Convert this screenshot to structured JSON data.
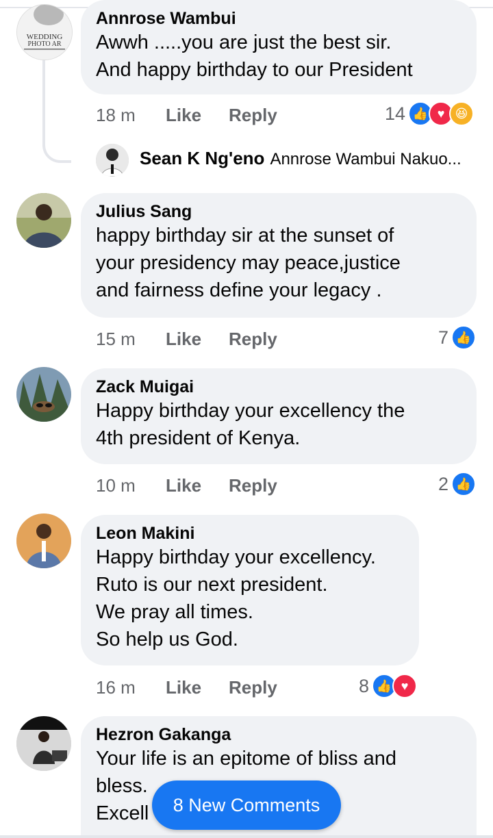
{
  "comments": [
    {
      "name": "Annrose Wambui",
      "lines": [
        "Awwh .....you are just the best sir.",
        "And happy birthday to our President"
      ],
      "time": "18 m",
      "like": "Like",
      "reply": "Reply",
      "reactions": "14",
      "reaction_icons": [
        "like-icon",
        "love-icon",
        "haha-icon"
      ],
      "avatar_text": "WEDDING PHOTO AR",
      "reply_preview": {
        "name": "Sean K Ng'eno",
        "text": "Annrose Wambui Nakuo..."
      }
    },
    {
      "name": "Julius Sang",
      "lines": [
        "happy birthday sir at the sunset of",
        "your presidency may peace,justice",
        "and fairness define your legacy ."
      ],
      "time": "15 m",
      "like": "Like",
      "reply": "Reply",
      "reactions": "7",
      "reaction_icons": [
        "like-icon"
      ]
    },
    {
      "name": "Zack Muigai",
      "lines": [
        "Happy birthday your excellency the",
        "4th president of Kenya."
      ],
      "time": "10 m",
      "like": "Like",
      "reply": "Reply",
      "reactions": "2",
      "reaction_icons": [
        "like-icon"
      ]
    },
    {
      "name": "Leon Makini",
      "lines": [
        "Happy birthday your excellency.",
        "Ruto is our next president.",
        "We pray all times.",
        "So help us God."
      ],
      "time": "16 m",
      "like": "Like",
      "reply": "Reply",
      "reactions": "8",
      "reaction_icons": [
        "like-icon",
        "love-icon"
      ]
    },
    {
      "name": "Hezron Gakanga",
      "lines": [
        "Your life is an epitome of bliss and",
        "bless.                    ur",
        "Excell"
      ]
    }
  ],
  "new_comments_button": "8 New Comments",
  "colors": {
    "accent": "#1877f2",
    "love": "#f02849",
    "haha": "#f7b125",
    "bubble": "#f0f2f5"
  }
}
